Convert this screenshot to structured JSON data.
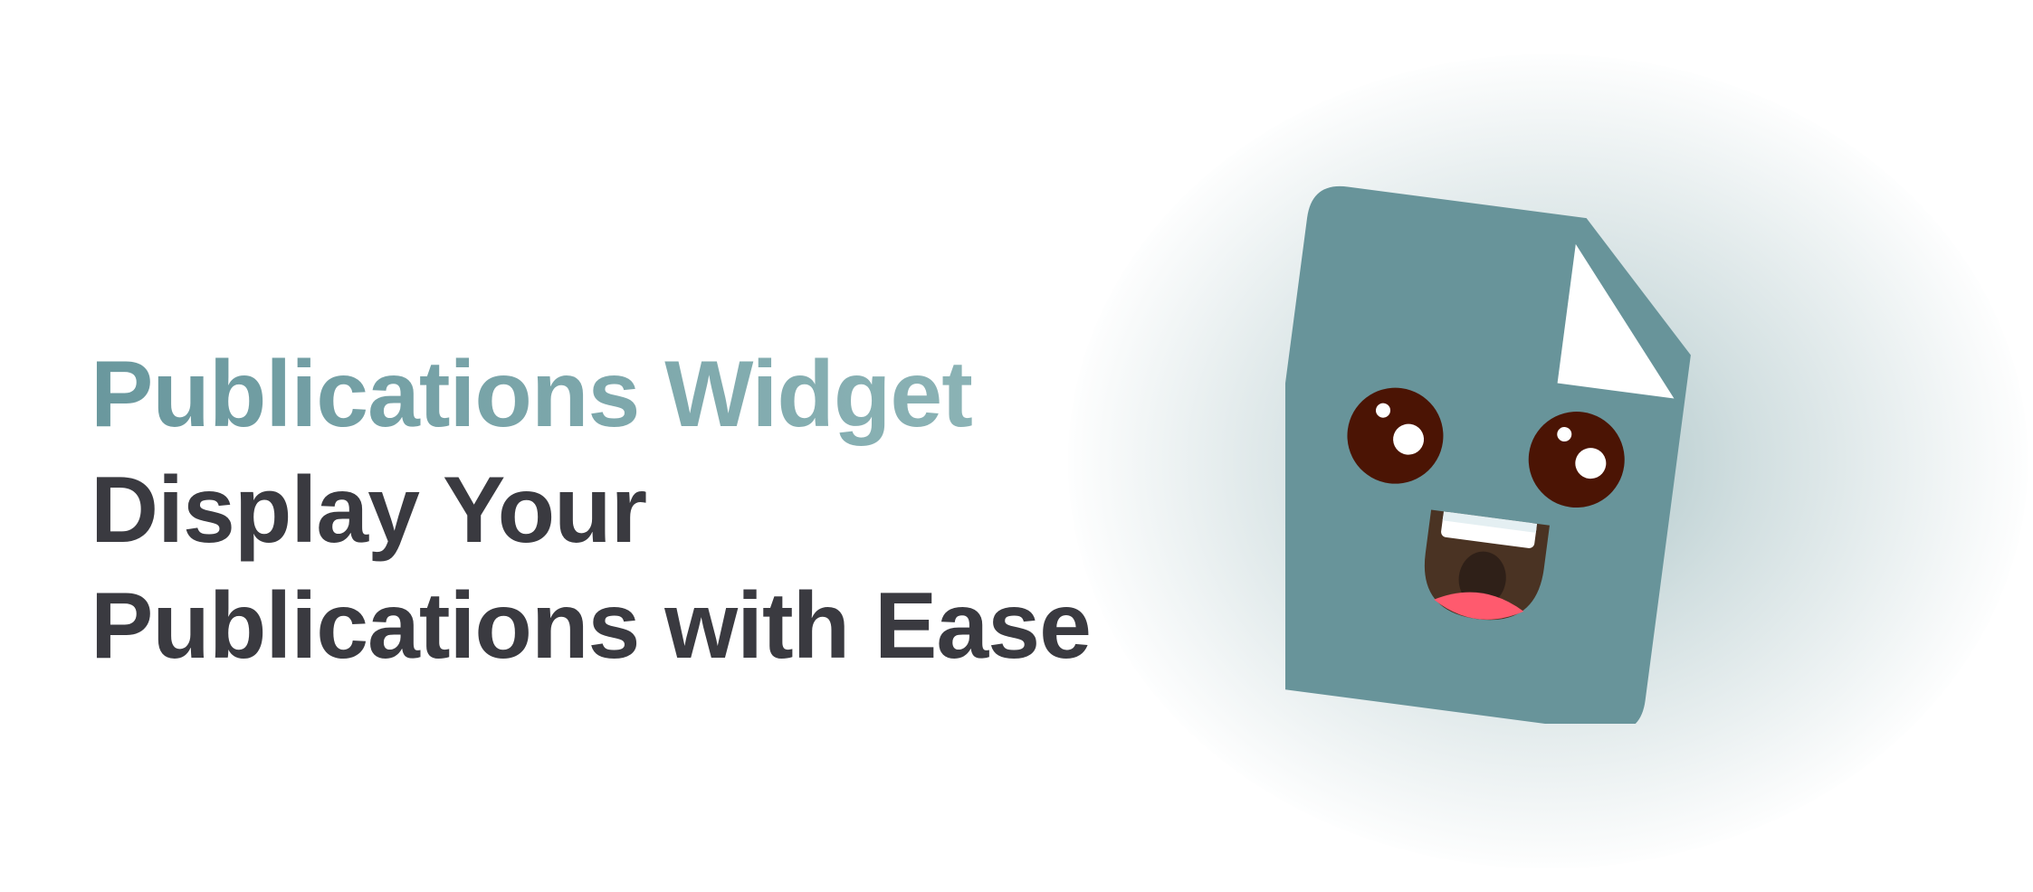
{
  "hero": {
    "title": "Publications Widget",
    "subtitle_line1": "Display Your",
    "subtitle_line2": "Publications with Ease"
  },
  "colors": {
    "accent_start": "#6a989e",
    "accent_end": "#8fb6b8",
    "text_dark": "#3a3a40",
    "document_body": "#68949a",
    "eye": "#4b1404",
    "mouth": "#4a3323",
    "tongue": "#ff5a6e"
  },
  "mascot": {
    "icon": "document-mascot-icon"
  }
}
